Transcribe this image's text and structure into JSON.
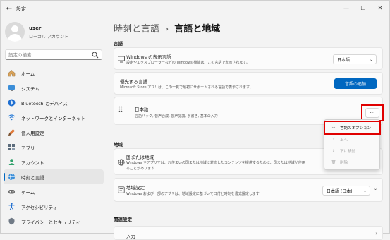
{
  "window": {
    "title": "設定",
    "back_icon": "back-arrow-icon",
    "minimize_icon": "minimize-icon",
    "maximize_icon": "maximize-icon",
    "close_icon": "close-icon"
  },
  "user": {
    "name": "user",
    "type": "ローカル アカウント"
  },
  "search": {
    "placeholder": "設定の検索"
  },
  "sidebar": {
    "items": [
      {
        "label": "ホーム",
        "icon": "home-icon"
      },
      {
        "label": "システム",
        "icon": "system-icon"
      },
      {
        "label": "Bluetooth とデバイス",
        "icon": "bluetooth-icon"
      },
      {
        "label": "ネットワークとインターネット",
        "icon": "wifi-icon"
      },
      {
        "label": "個人用設定",
        "icon": "brush-icon"
      },
      {
        "label": "アプリ",
        "icon": "apps-icon"
      },
      {
        "label": "アカウント",
        "icon": "account-icon"
      },
      {
        "label": "時刻と言語",
        "icon": "globe-clock-icon",
        "active": true
      },
      {
        "label": "ゲーム",
        "icon": "game-icon"
      },
      {
        "label": "アクセシビリティ",
        "icon": "accessibility-icon"
      },
      {
        "label": "プライバシーとセキュリティ",
        "icon": "shield-icon"
      }
    ]
  },
  "breadcrumb": {
    "parent": "時刻と言語",
    "separator": "›",
    "current": "言語と地域"
  },
  "sections": {
    "language": "言語",
    "region": "地域",
    "related": "関連設定"
  },
  "display_language": {
    "title": "Windows の表示言語",
    "subtitle": "設定やエクスプローラーなどの Windows 機能は、この言語で表示されます。",
    "value": "日本語"
  },
  "preferred_languages": {
    "title": "優先する言語",
    "subtitle": "Microsoft Store アプリは、この一覧で最初にサポートされる言語で表示されます。",
    "button": "言語の追加"
  },
  "japanese": {
    "title": "日本語",
    "subtitle": "言語パック, 音声合成, 音声認識, 手書き, 基本の入力",
    "more_label": "···"
  },
  "context_menu": {
    "items": [
      {
        "label": "言語のオプション",
        "icon": "···",
        "disabled": false
      },
      {
        "label": "上へ",
        "icon": "↑",
        "disabled": true
      },
      {
        "label": "下に移動",
        "icon": "↓",
        "disabled": true
      },
      {
        "label": "削除",
        "icon": "🗑",
        "disabled": true
      }
    ]
  },
  "country": {
    "title": "国または地域",
    "subtitle_line1": "Windows やアプリでは、お住まいの国または地域に対応したコンテンツを提供するために、国または地域が使用",
    "subtitle_line2": "ることがあります"
  },
  "regional_format": {
    "title": "地域設定",
    "subtitle": "Windows および一部のアプリは、地域設定に基づいて日付と時刻を書式設定します",
    "value": "日本語 (日本)"
  },
  "related_first": {
    "title": "入力"
  },
  "colors": {
    "accent": "#0067c0",
    "highlight": "#e00000"
  }
}
